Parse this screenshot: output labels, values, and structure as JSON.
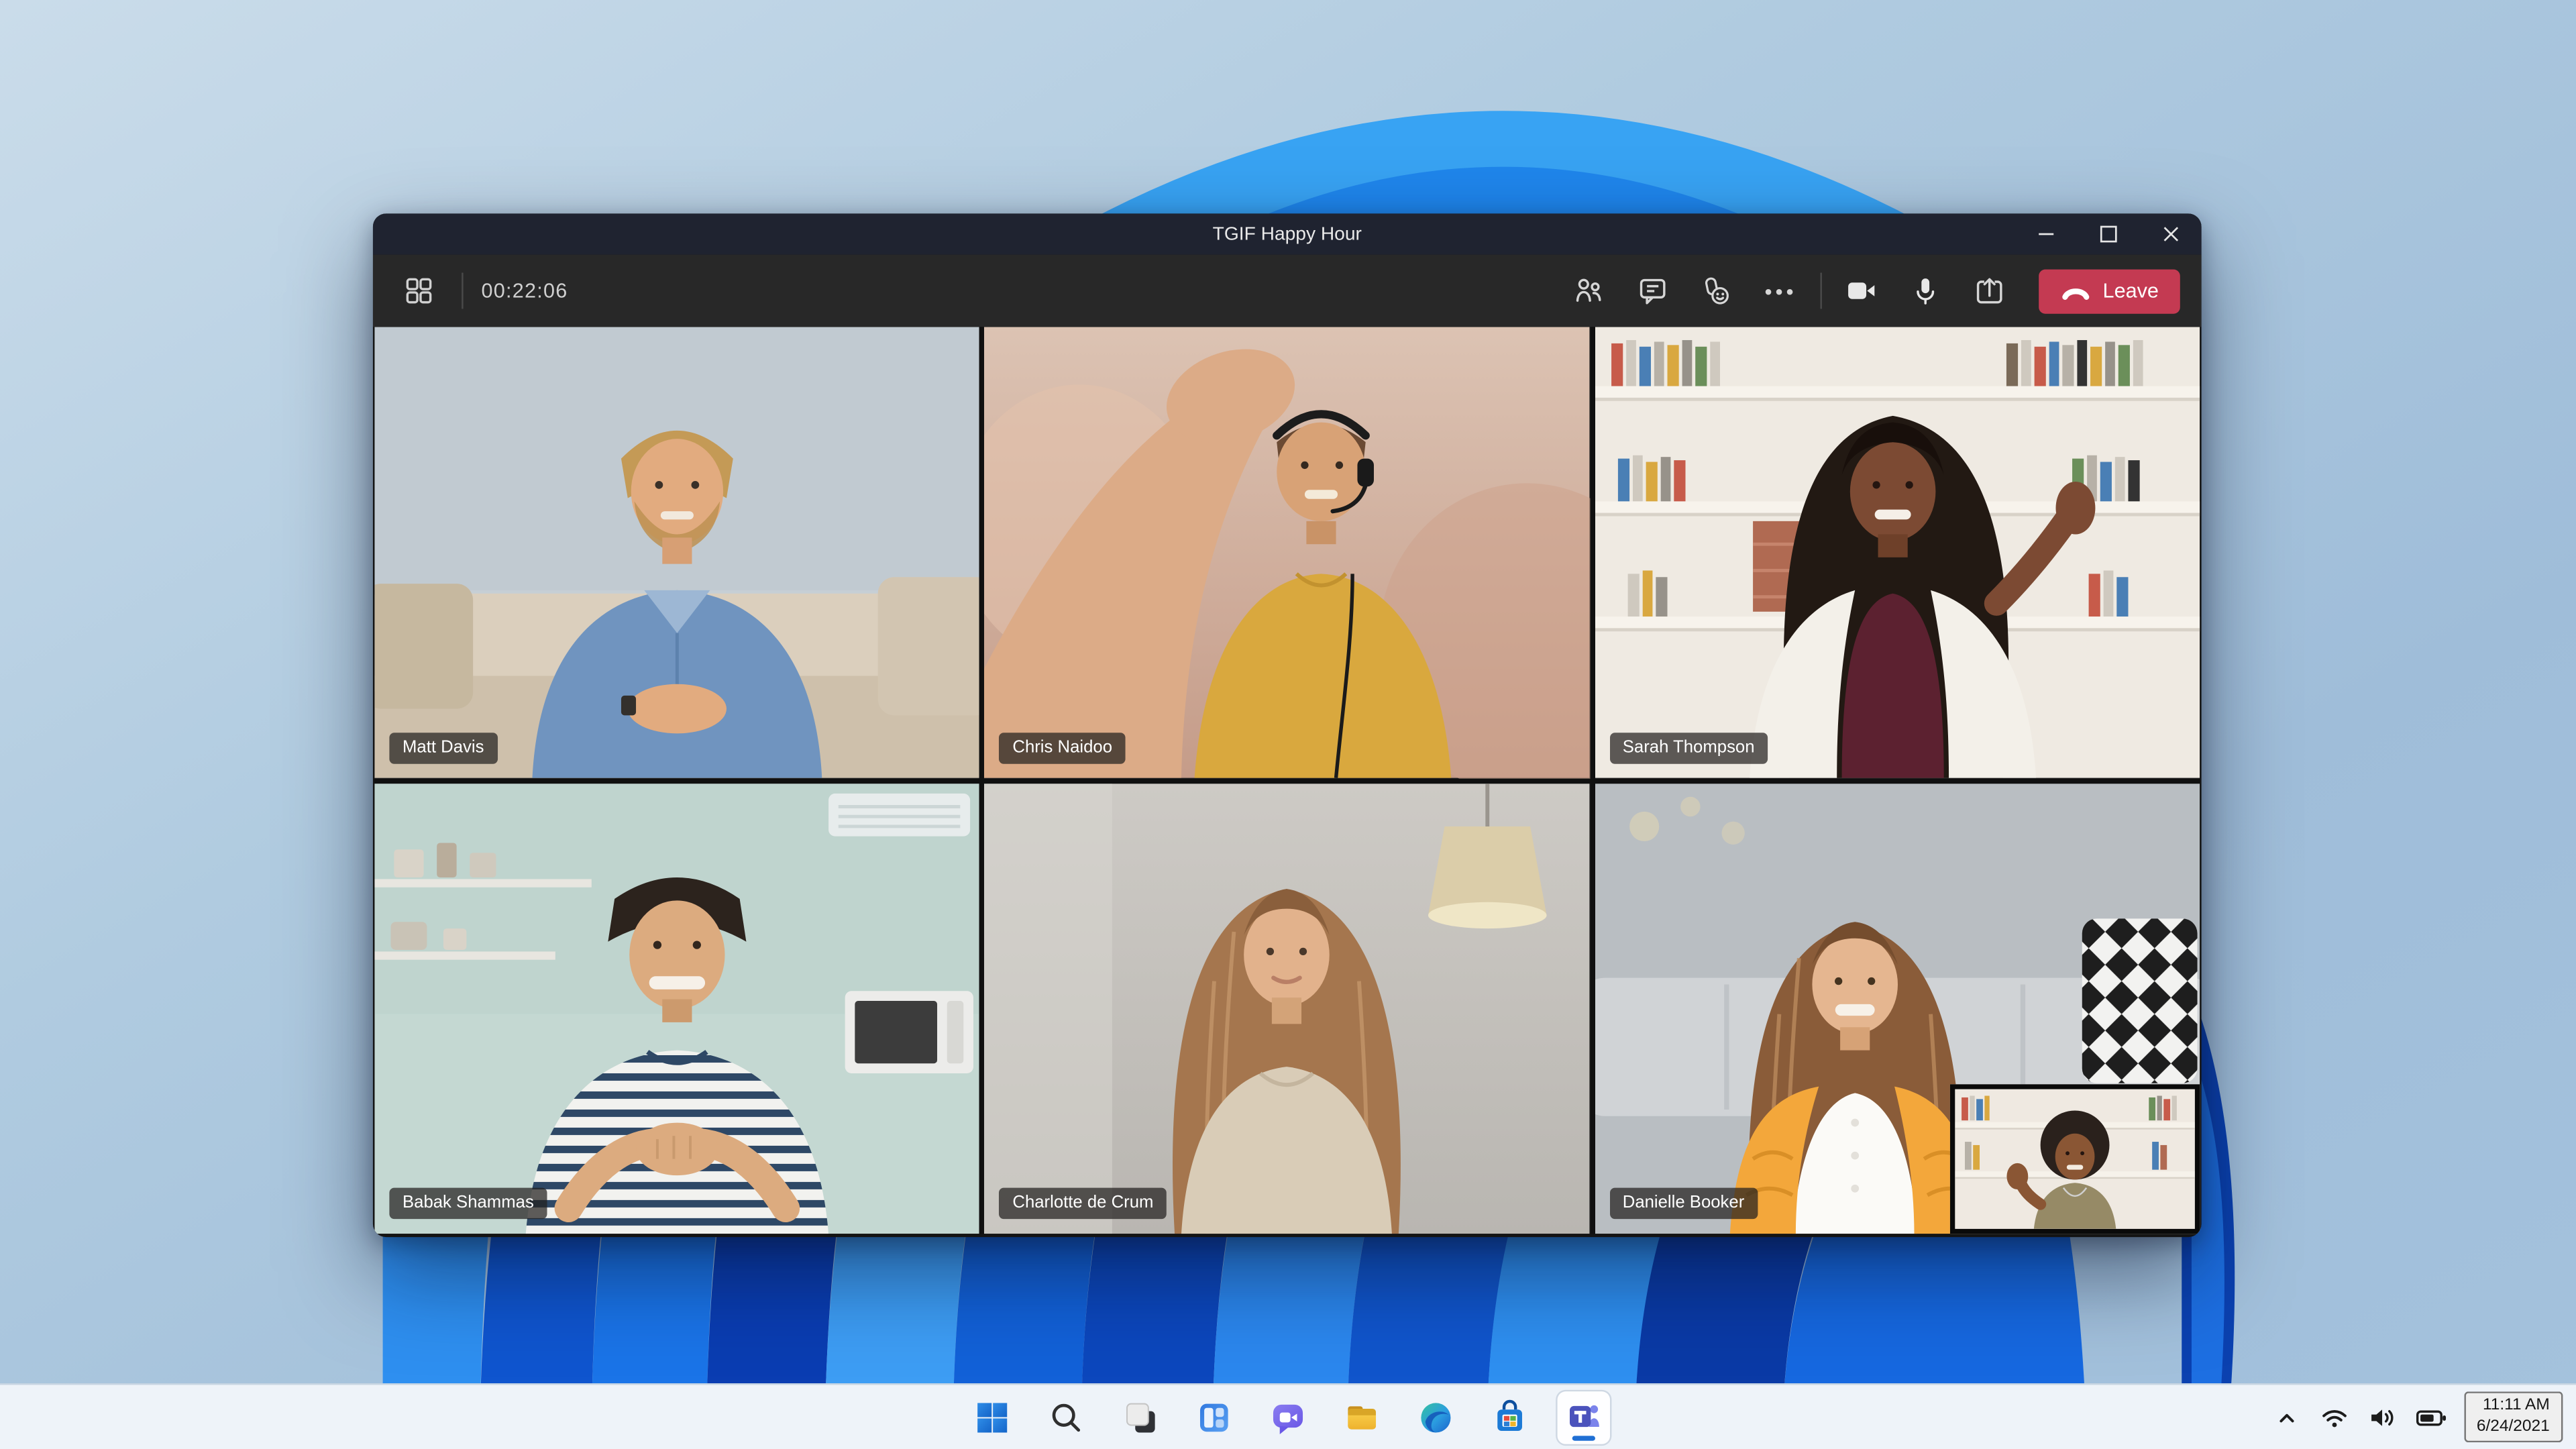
{
  "window": {
    "title": "TGIF Happy Hour"
  },
  "meeting_toolbar": {
    "timer": "00:22:06",
    "more_glyph": "•••",
    "leave_label": "Leave"
  },
  "participants": [
    {
      "name": "Matt Davis"
    },
    {
      "name": "Chris Naidoo"
    },
    {
      "name": "Sarah Thompson"
    },
    {
      "name": "Babak Shammas"
    },
    {
      "name": "Charlotte de Crum"
    },
    {
      "name": "Danielle Booker"
    }
  ],
  "taskbar": {
    "tray_time": "11:11 AM",
    "tray_date": "6/24/2021"
  },
  "colors": {
    "leave_red": "#c43a52",
    "titlebar_bg": "#1f2330",
    "toolbar_bg": "#282828",
    "taskbar_bg": "#eef3f9",
    "accent_blue": "#1f6fd4",
    "teams_purple": "#4b53bc"
  }
}
